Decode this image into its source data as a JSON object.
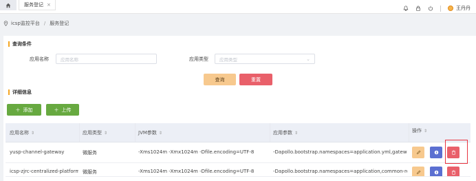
{
  "topbar": {
    "home_icon": "home-icon",
    "active_tab": "服务登记",
    "close_glyph": "×",
    "user_name": "王丹丹"
  },
  "breadcrumb": {
    "root": "icsp监控平台",
    "separator": "/",
    "current": "服务登记"
  },
  "search": {
    "section_title": "查询条件",
    "app_name_label": "应用名称",
    "app_name_placeholder": "应用名称",
    "app_type_label": "应用类型",
    "app_type_placeholder": "应用类型",
    "query_button": "查询",
    "reset_button": "重置"
  },
  "details": {
    "section_title": "详细信息",
    "add_button": "添加",
    "upload_button": "上传"
  },
  "table": {
    "columns": [
      "应用名称",
      "应用类型",
      "JVM参数",
      "应用参数",
      "操作"
    ],
    "rows": [
      {
        "name": "yusp-channel-gateway",
        "type": "微服务",
        "jvm": "-Xms1024m -Xmx1024m -Dfile.encoding=UTF-8",
        "params": "-Dapollo.bootstrap.namespaces=application.yml,gateway-ap"
      },
      {
        "name": "icsp-zjrc-centralized-platform",
        "type": "微服务",
        "jvm": "-Xms1024m -Xmx1024m -Dfile.encoding=UTF-8",
        "params": "-Dapollo.bootstrap.namespaces=application,common-redis,"
      }
    ]
  },
  "colors": {
    "accent": "#f5a623",
    "query": "#f7c98e",
    "reset": "#e9606a",
    "green": "#67a940",
    "info": "#5b6fd1",
    "highlight": "#e8333f"
  }
}
